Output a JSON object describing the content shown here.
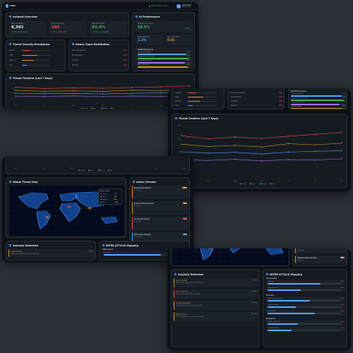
{
  "app": {
    "logo": "CIRIS",
    "status": "System Status: Online",
    "user_name": "Admin User",
    "user_role": "Administrator"
  },
  "incident": {
    "title": "Incident Overview",
    "kpis": [
      {
        "label": "Total Incidents",
        "value": "8,392",
        "delta": "↑ 12% vs last month",
        "color": "#e6edf3"
      },
      {
        "label": "Critical Threats",
        "value": "193",
        "delta": "↑ 8% vs last month",
        "color": "#f85149"
      },
      {
        "label": "Resolution Rate",
        "value": "93.4%",
        "delta": "↑ 2.1% vs last month",
        "color": "#3fb950"
      }
    ]
  },
  "ai": {
    "title": "AI Performance",
    "accuracy_label": "Detection Accuracy",
    "accuracy_value": "98.5%",
    "accuracy_delta": "↑ 1.2%",
    "fp_label": "False Positives",
    "fp_value": "1.3%",
    "rt_label": "Response Time",
    "rt_value": "0.8s",
    "models_title": "Model Performance",
    "models": [
      {
        "name": "Zero-day Exploits",
        "pct": 92,
        "label": "92%",
        "color": "#58a6ff"
      },
      {
        "name": "Ransomware Detection",
        "pct": 96,
        "label": "96%",
        "color": "#3fb950"
      },
      {
        "name": "Threat Classification",
        "pct": 89,
        "label": "89%",
        "color": "#a371f7"
      },
      {
        "name": "Behavioral Anal.",
        "pct": 94,
        "label": "94%",
        "color": "#d29922"
      }
    ]
  },
  "severity": {
    "title": "Threat Severity Breakdown",
    "items": [
      {
        "name": "Critical",
        "pct": 30,
        "color": "#f85149"
      },
      {
        "name": "High",
        "pct": 55,
        "color": "#f0883e"
      },
      {
        "name": "Medium",
        "pct": 42,
        "color": "#d29922"
      },
      {
        "name": "Low",
        "pct": 18,
        "color": "#58a6ff"
      }
    ]
  },
  "attack_types": {
    "title": "Attack Types Distribution",
    "items": [
      {
        "name": "Zero-day Exploits",
        "pct": 19,
        "label": "19%"
      },
      {
        "name": "Ransomware",
        "pct": 33,
        "label": "33%"
      },
      {
        "name": "Phishing",
        "pct": 28,
        "label": "28%"
      },
      {
        "name": "Malware",
        "pct": 20,
        "label": "20%"
      }
    ]
  },
  "timeline": {
    "title": "Threat Timeline (Last 7 Days)"
  },
  "chart_data": {
    "type": "line",
    "title": "Threat Timeline (Last 7 Days)",
    "x": [
      "Mon",
      "Tue",
      "Wed",
      "Thu",
      "Fri",
      "Sat",
      "Sun"
    ],
    "ylim": [
      0,
      200
    ],
    "grid": true,
    "legend": "bottom",
    "series": [
      {
        "name": "Critical",
        "color": "#f85149",
        "values": [
          160,
          148,
          155,
          150,
          158,
          165,
          172
        ]
      },
      {
        "name": "High",
        "color": "#d29922",
        "values": [
          128,
          120,
          124,
          118,
          130,
          126,
          132
        ]
      },
      {
        "name": "Medium",
        "color": "#58a6ff",
        "values": [
          100,
          95,
          98,
          92,
          99,
          102,
          104
        ]
      },
      {
        "name": "Low",
        "color": "#a371f7",
        "values": [
          70,
          68,
          72,
          66,
          71,
          69,
          74
        ]
      }
    ]
  },
  "threat_map": {
    "title": "Global Threat Map",
    "legend": [
      {
        "name": "Critical",
        "value": "193",
        "color": "#f85149"
      },
      {
        "name": "High",
        "value": "421",
        "color": "#f0883e"
      },
      {
        "name": "Medium",
        "value": "862",
        "color": "#d29922"
      },
      {
        "name": "Low",
        "value": "1,204",
        "color": "#58a6ff"
      }
    ],
    "hotspots": [
      {
        "cx": 52,
        "cy": 42,
        "color": "#f85149"
      },
      {
        "cx": 70,
        "cy": 45,
        "color": "#d29922"
      },
      {
        "cx": 33,
        "cy": 63,
        "color": "#f0883e"
      }
    ]
  },
  "active_threats": {
    "title": "Active Threats",
    "items": [
      {
        "name": "Ransomware Attempt",
        "time": "2 min ago",
        "level": "High",
        "color": "#f0883e"
      },
      {
        "name": "Suspicious File Download",
        "time": "5 min ago",
        "level": "Med",
        "color": "#d29922"
      },
      {
        "name": "Unusual API Activity",
        "time": "8 min ago",
        "level": "Crit",
        "color": "#f85149"
      },
      {
        "name": "Failed Login Attempts",
        "time": "12 min ago",
        "level": "Low",
        "color": "#58a6ff"
      }
    ]
  },
  "anomaly": {
    "title": "Anomaly Detection",
    "items": [
      {
        "name": "Login Anomaly",
        "desc": "Multiple failed logins from IP 192.168.1.45",
        "time": "2m ago",
        "color": "#d29922"
      },
      {
        "name": "Data Exfiltration",
        "desc": "Unusual outbound traffic on port 443",
        "time": "6m ago",
        "color": "#f85149"
      },
      {
        "name": "Privilege Escalation",
        "desc": "Unexpected admin access by user_042",
        "time": "11m ago",
        "color": "#f0883e"
      },
      {
        "name": "Network Scan",
        "desc": "Port scanning detected from external host",
        "time": "15m ago",
        "color": "#d29922"
      }
    ]
  },
  "mitre": {
    "title": "MITRE ATT&CK Mapping",
    "groups": [
      {
        "name": "Initial Access",
        "items": [
          {
            "name": "Phishing",
            "pct": 72,
            "label": "72%"
          },
          {
            "name": "Valid Accounts",
            "pct": 45,
            "label": "45%"
          }
        ]
      },
      {
        "name": "Execution",
        "items": [
          {
            "name": "Command & Scripting",
            "pct": 58,
            "label": "58%"
          },
          {
            "name": "User Execution",
            "pct": 38,
            "label": "38%"
          },
          {
            "name": "PowerShell",
            "pct": 64,
            "label": "64%"
          }
        ]
      },
      {
        "name": "Persistence",
        "items": [
          {
            "name": "Registry Run Keys",
            "pct": 41,
            "label": "41%"
          },
          {
            "name": "Scheduled Task",
            "pct": 33,
            "label": "33%"
          }
        ]
      }
    ]
  }
}
